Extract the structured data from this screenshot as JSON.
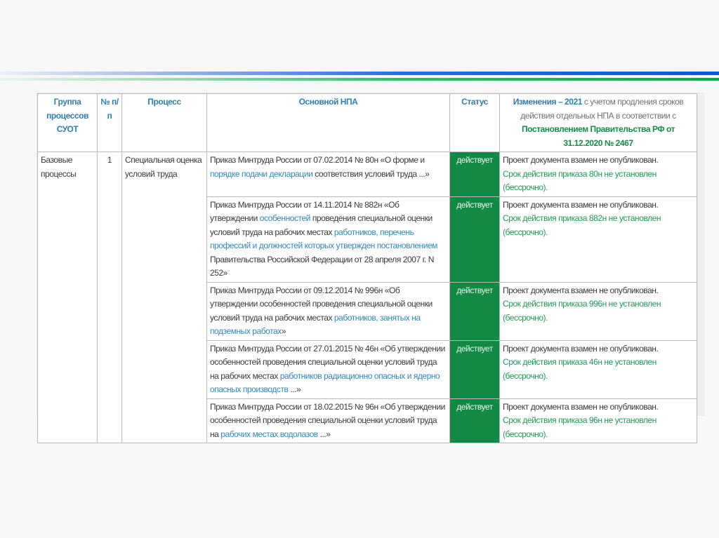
{
  "header": {
    "group": "Группа процессов СУОТ",
    "num": "№ п/п",
    "process": "Процесс",
    "npa": "Основной НПА",
    "status": "Статус",
    "changes_bold": "Изменения – 2021",
    "changes_text": " с учетом продления сроков действия отдельных НПА в соответствии с ",
    "changes_decree": "Постановлением Правительства РФ от 31.12.2020 № 2467"
  },
  "group_name": "Базовые процессы",
  "num": "1",
  "process": "Специальная оценка условий труда",
  "rows": [
    {
      "npa": [
        {
          "t": "Приказ Минтруда России от 07.02.2014 № 80н «О форме и ",
          "hl": false
        },
        {
          "t": "порядке подачи декларации",
          "hl": true
        },
        {
          "t": " соответствия условий труда ...»",
          "hl": false
        }
      ],
      "status": "действует",
      "note": "Проект документа взамен не опубликован.",
      "term": "Срок действия приказа 80н не установлен (бессрочно)."
    },
    {
      "npa": [
        {
          "t": "Приказ Минтруда России от 14.11.2014 № 882н «Об утверждении ",
          "hl": false
        },
        {
          "t": "особенностей",
          "hl": true
        },
        {
          "t": " проведения специальной оценки условий труда на рабочих местах ",
          "hl": false
        },
        {
          "t": "работников, перечень профессий и должностей которых утвержден постановлением",
          "hl": true
        },
        {
          "t": " Правительства Российской Федерации от 28 апреля 2007 г. N 252»",
          "hl": false
        }
      ],
      "status": "действует",
      "note": "Проект документа взамен не опубликован.",
      "term": "Срок действия приказа 882н не установлен (бессрочно)."
    },
    {
      "npa": [
        {
          "t": "Приказ Минтруда России от 09.12.2014 № 996н «Об утверждении особенностей проведения специальной оценки условий труда на рабочих местах ",
          "hl": false
        },
        {
          "t": "работников, занятых на подземных работах",
          "hl": true
        },
        {
          "t": "»",
          "hl": false
        }
      ],
      "status": "действует",
      "note": "Проект документа взамен не опубликован.",
      "term": "Срок действия приказа 996н не установлен (бессрочно)."
    },
    {
      "npa": [
        {
          "t": "Приказ Минтруда России от 27.01.2015 № 46н «Об утверждении особенностей проведения специальной оценки условий труда на рабочих местах ",
          "hl": false
        },
        {
          "t": "работников радиационно опасных и ядерно опасных производств",
          "hl": true
        },
        {
          "t": " ...»",
          "hl": false
        }
      ],
      "status": "действует",
      "note": "Проект документа взамен не опубликован.",
      "term": "Срок действия приказа 46н не установлен (бессрочно)."
    },
    {
      "npa": [
        {
          "t": "Приказ Минтруда России от 18.02.2015 № 96н «Об утверждении особенностей проведения специальной оценки условий труда на ",
          "hl": false
        },
        {
          "t": "рабочих местах водолазов",
          "hl": true
        },
        {
          "t": " ...»",
          "hl": false
        }
      ],
      "status": "действует",
      "note": "Проект документа взамен не опубликован.",
      "term": "Срок действия приказа 96н не установлен (бессрочно)."
    }
  ]
}
